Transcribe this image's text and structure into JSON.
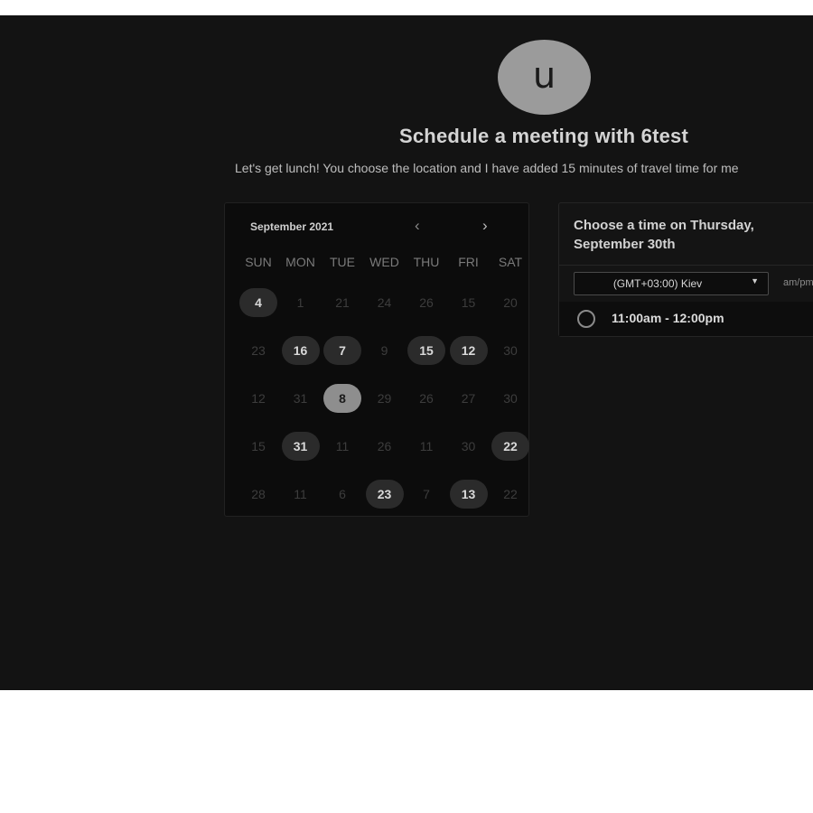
{
  "avatar_letter": "u",
  "title": "Schedule a meeting with 6test",
  "description": "Let's get lunch! You choose the location and I have added 15 minutes of travel time for me",
  "calendar": {
    "month_label": "September 2021",
    "prev_icon": "‹",
    "next_icon": "›",
    "weekdays": [
      "SUN",
      "MON",
      "TUE",
      "WED",
      "THU",
      "FRI",
      "SAT"
    ],
    "weeks": [
      [
        {
          "d": "4",
          "s": "avail"
        },
        {
          "d": "1",
          "s": "off"
        },
        {
          "d": "21",
          "s": "off"
        },
        {
          "d": "24",
          "s": "off"
        },
        {
          "d": "26",
          "s": "off"
        },
        {
          "d": "15",
          "s": "off"
        },
        {
          "d": "20",
          "s": "off"
        }
      ],
      [
        {
          "d": "23",
          "s": "off"
        },
        {
          "d": "16",
          "s": "avail"
        },
        {
          "d": "7",
          "s": "avail"
        },
        {
          "d": "9",
          "s": "off"
        },
        {
          "d": "15",
          "s": "avail"
        },
        {
          "d": "12",
          "s": "avail"
        },
        {
          "d": "30",
          "s": "off"
        }
      ],
      [
        {
          "d": "12",
          "s": "off"
        },
        {
          "d": "31",
          "s": "off"
        },
        {
          "d": "8",
          "s": "selected"
        },
        {
          "d": "29",
          "s": "off"
        },
        {
          "d": "26",
          "s": "off"
        },
        {
          "d": "27",
          "s": "off"
        },
        {
          "d": "30",
          "s": "off"
        }
      ],
      [
        {
          "d": "15",
          "s": "off"
        },
        {
          "d": "31",
          "s": "avail"
        },
        {
          "d": "11",
          "s": "off"
        },
        {
          "d": "26",
          "s": "off"
        },
        {
          "d": "11",
          "s": "off"
        },
        {
          "d": "30",
          "s": "off"
        },
        {
          "d": "22",
          "s": "avail"
        }
      ],
      [
        {
          "d": "28",
          "s": "off"
        },
        {
          "d": "11",
          "s": "off"
        },
        {
          "d": "6",
          "s": "off"
        },
        {
          "d": "23",
          "s": "avail"
        },
        {
          "d": "7",
          "s": "off"
        },
        {
          "d": "13",
          "s": "avail"
        },
        {
          "d": "22",
          "s": "off"
        }
      ]
    ]
  },
  "time_panel": {
    "heading": "Choose a time on Thursday, September 30th",
    "timezone": "(GMT+03:00) Kiev",
    "timezone_caret": "▼",
    "format_toggle": "am/pm",
    "slots": [
      "11:00am - 12:00pm"
    ]
  },
  "colors": {
    "background": "#131313",
    "available_day": "#2b2b2b",
    "selected_day": "#8e8e8e",
    "avatar": "#9b9b9b"
  }
}
